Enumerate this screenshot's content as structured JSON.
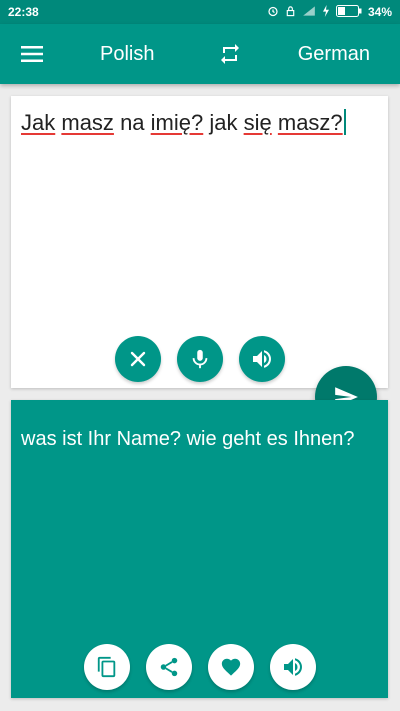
{
  "status_bar": {
    "time": "22:38",
    "battery": "34%"
  },
  "toolbar": {
    "source_language": "Polish",
    "target_language": "German"
  },
  "input": {
    "words": [
      "Jak",
      "masz",
      "na",
      "imię?",
      "jak",
      "się",
      "masz?"
    ],
    "misspelled_flags": [
      false,
      true,
      false,
      true,
      false,
      true,
      true
    ]
  },
  "output": {
    "text": "was ist Ihr Name? wie geht es Ihnen?"
  },
  "colors": {
    "primary": "#009688",
    "primary_dark": "#00897b",
    "fab": "#00796b",
    "spell_error": "#e53935"
  },
  "icons": {
    "input_actions": [
      "close-icon",
      "microphone-icon",
      "speaker-icon"
    ],
    "output_actions": [
      "copy-icon",
      "share-icon",
      "heart-icon",
      "speaker-icon"
    ],
    "send": "send-icon"
  }
}
